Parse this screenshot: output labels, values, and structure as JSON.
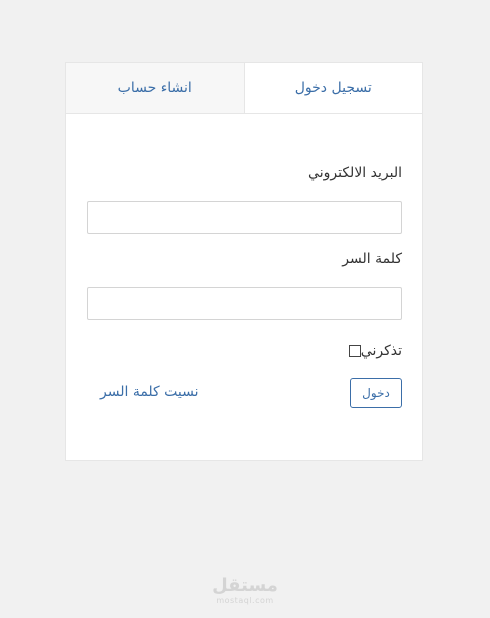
{
  "tabs": {
    "login": "تسجيل دخول",
    "register": "انشاء حساب"
  },
  "form": {
    "email_label": "البريد الالكتروني",
    "email_value": "",
    "password_label": "كلمة السر",
    "password_value": "",
    "remember_label": "تذكرني",
    "remember_checked": false,
    "login_button": "دخول",
    "forgot_link": "نسيت كلمة السر"
  },
  "watermark": {
    "brand": "مستقل",
    "url": "mostaql.com"
  },
  "colors": {
    "accent": "#3b6ea8",
    "background": "#f1f1f1",
    "card": "#ffffff",
    "border": "#e6e6e6"
  }
}
